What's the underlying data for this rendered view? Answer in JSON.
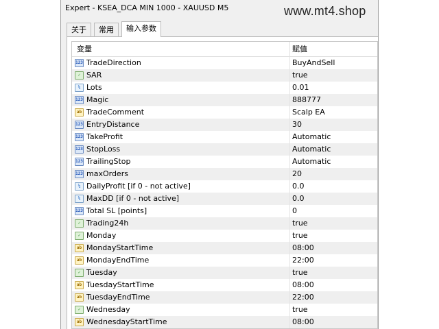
{
  "window": {
    "title": "Expert - KSEA_DCA MIN 1000 - XAUUSD M5"
  },
  "watermark": "www.mt4.shop",
  "tabs": [
    {
      "label": "关于"
    },
    {
      "label": "常用"
    },
    {
      "label": "输入参数",
      "active": true
    }
  ],
  "table": {
    "headers": {
      "variable": "变量",
      "value": "赋值"
    },
    "rows": [
      {
        "type": "int",
        "icon": "integer-type-icon",
        "name": "TradeDirection",
        "value": "BuyAndSell"
      },
      {
        "type": "bool",
        "icon": "boolean-type-icon",
        "name": "SAR",
        "value": "true"
      },
      {
        "type": "dbl",
        "icon": "double-type-icon",
        "name": "Lots",
        "value": "0.01"
      },
      {
        "type": "int",
        "icon": "integer-type-icon",
        "name": "Magic",
        "value": "888777"
      },
      {
        "type": "str",
        "icon": "string-type-icon",
        "name": "TradeComment",
        "value": "Scalp EA"
      },
      {
        "type": "int",
        "icon": "integer-type-icon",
        "name": "EntryDistance",
        "value": "30"
      },
      {
        "type": "int",
        "icon": "integer-type-icon",
        "name": "TakeProfit",
        "value": "Automatic"
      },
      {
        "type": "int",
        "icon": "integer-type-icon",
        "name": "StopLoss",
        "value": "Automatic"
      },
      {
        "type": "int",
        "icon": "integer-type-icon",
        "name": "TrailingStop",
        "value": "Automatic"
      },
      {
        "type": "int",
        "icon": "integer-type-icon",
        "name": "maxOrders",
        "value": "20"
      },
      {
        "type": "dbl",
        "icon": "double-type-icon",
        "name": "DailyProfit [if 0 - not active]",
        "value": "0.0"
      },
      {
        "type": "dbl",
        "icon": "double-type-icon",
        "name": "MaxDD [if 0 - not active]",
        "value": "0.0"
      },
      {
        "type": "int",
        "icon": "integer-type-icon",
        "name": "Total SL [points]",
        "value": "0"
      },
      {
        "type": "bool",
        "icon": "boolean-type-icon",
        "name": "Trading24h",
        "value": "true"
      },
      {
        "type": "bool",
        "icon": "boolean-type-icon",
        "name": "Monday",
        "value": "true"
      },
      {
        "type": "str",
        "icon": "string-type-icon",
        "name": "MondayStartTime",
        "value": "08:00"
      },
      {
        "type": "str",
        "icon": "string-type-icon",
        "name": "MondayEndTime",
        "value": "22:00"
      },
      {
        "type": "bool",
        "icon": "boolean-type-icon",
        "name": "Tuesday",
        "value": "true"
      },
      {
        "type": "str",
        "icon": "string-type-icon",
        "name": "TuesdayStartTime",
        "value": "08:00"
      },
      {
        "type": "str",
        "icon": "string-type-icon",
        "name": "TuesdayEndTime",
        "value": "22:00"
      },
      {
        "type": "bool",
        "icon": "boolean-type-icon",
        "name": "Wednesday",
        "value": "true"
      },
      {
        "type": "str",
        "icon": "string-type-icon",
        "name": "WednesdayStartTime",
        "value": "08:00"
      }
    ]
  }
}
